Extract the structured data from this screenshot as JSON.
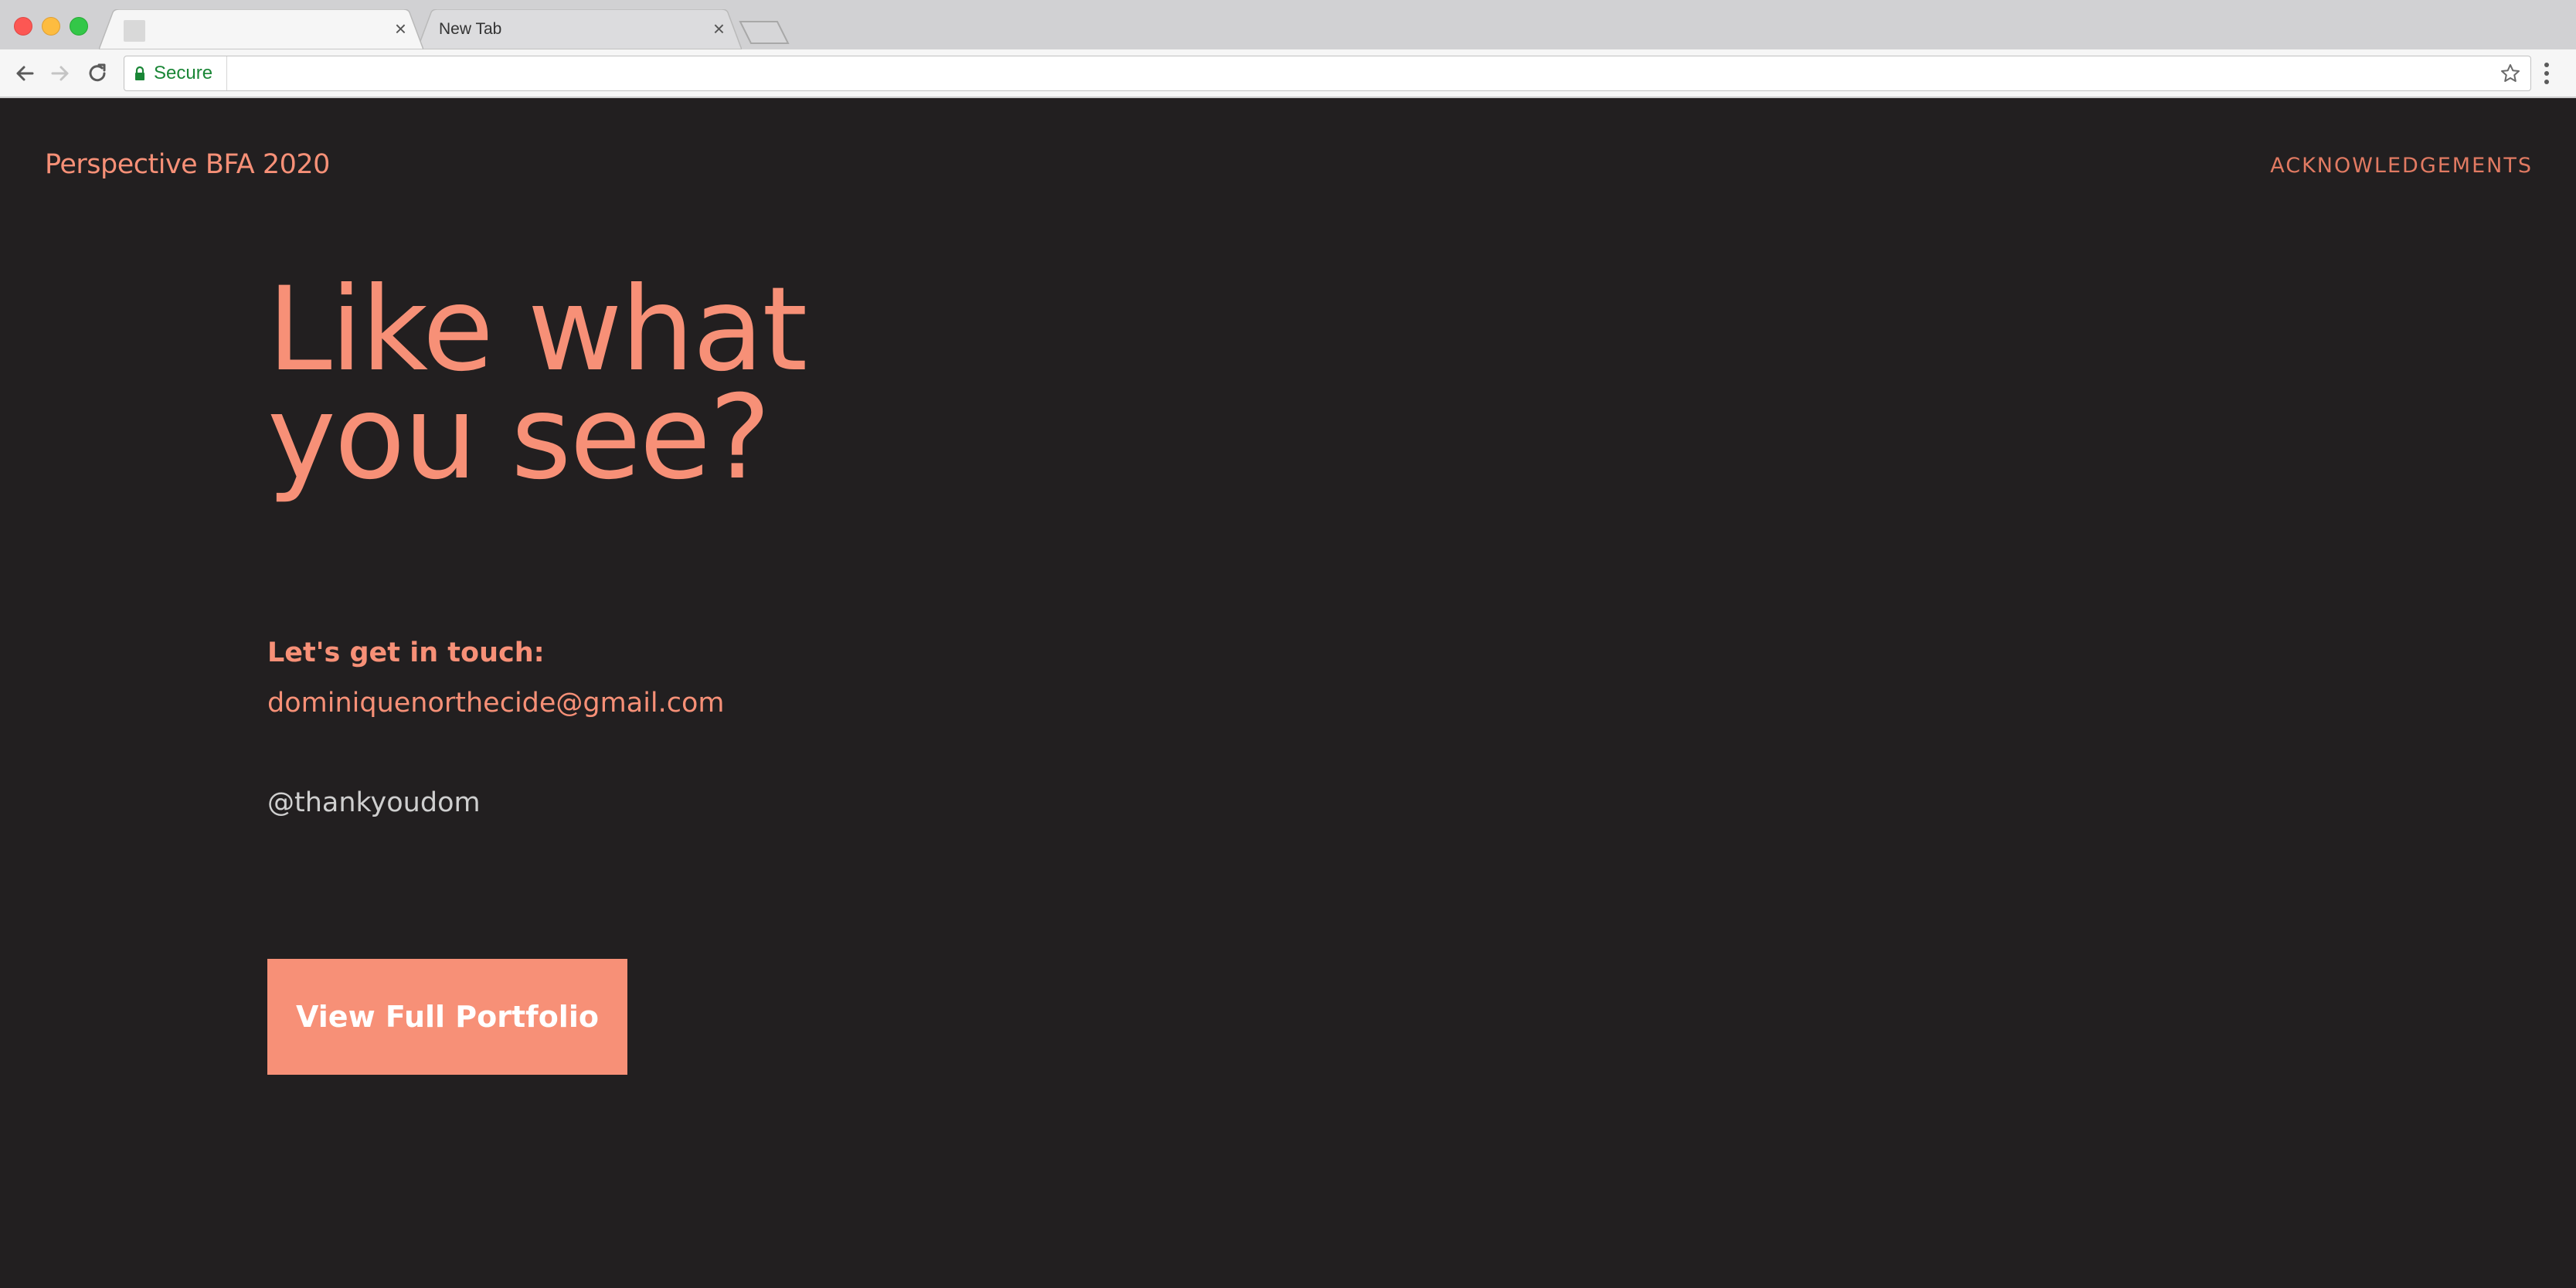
{
  "browser": {
    "tabs": [
      {
        "title": ""
      },
      {
        "title": "New Tab"
      }
    ],
    "close_glyph": "×",
    "security_label": "Secure",
    "url": ""
  },
  "site": {
    "brand": "Perspective BFA 2020",
    "nav_link": "ACKNOWLEDGEMENTS",
    "headline_line1": "Like what",
    "headline_line2": "you see?",
    "contact_label": "Let's get in touch:",
    "email": "dominiquenorthecide@gmail.com",
    "handle": "@thankyoudom",
    "cta_label": "View Full Portfolio"
  },
  "colors": {
    "background": "#221f20",
    "accent": "#f79077",
    "secure_green": "#1a8636"
  }
}
